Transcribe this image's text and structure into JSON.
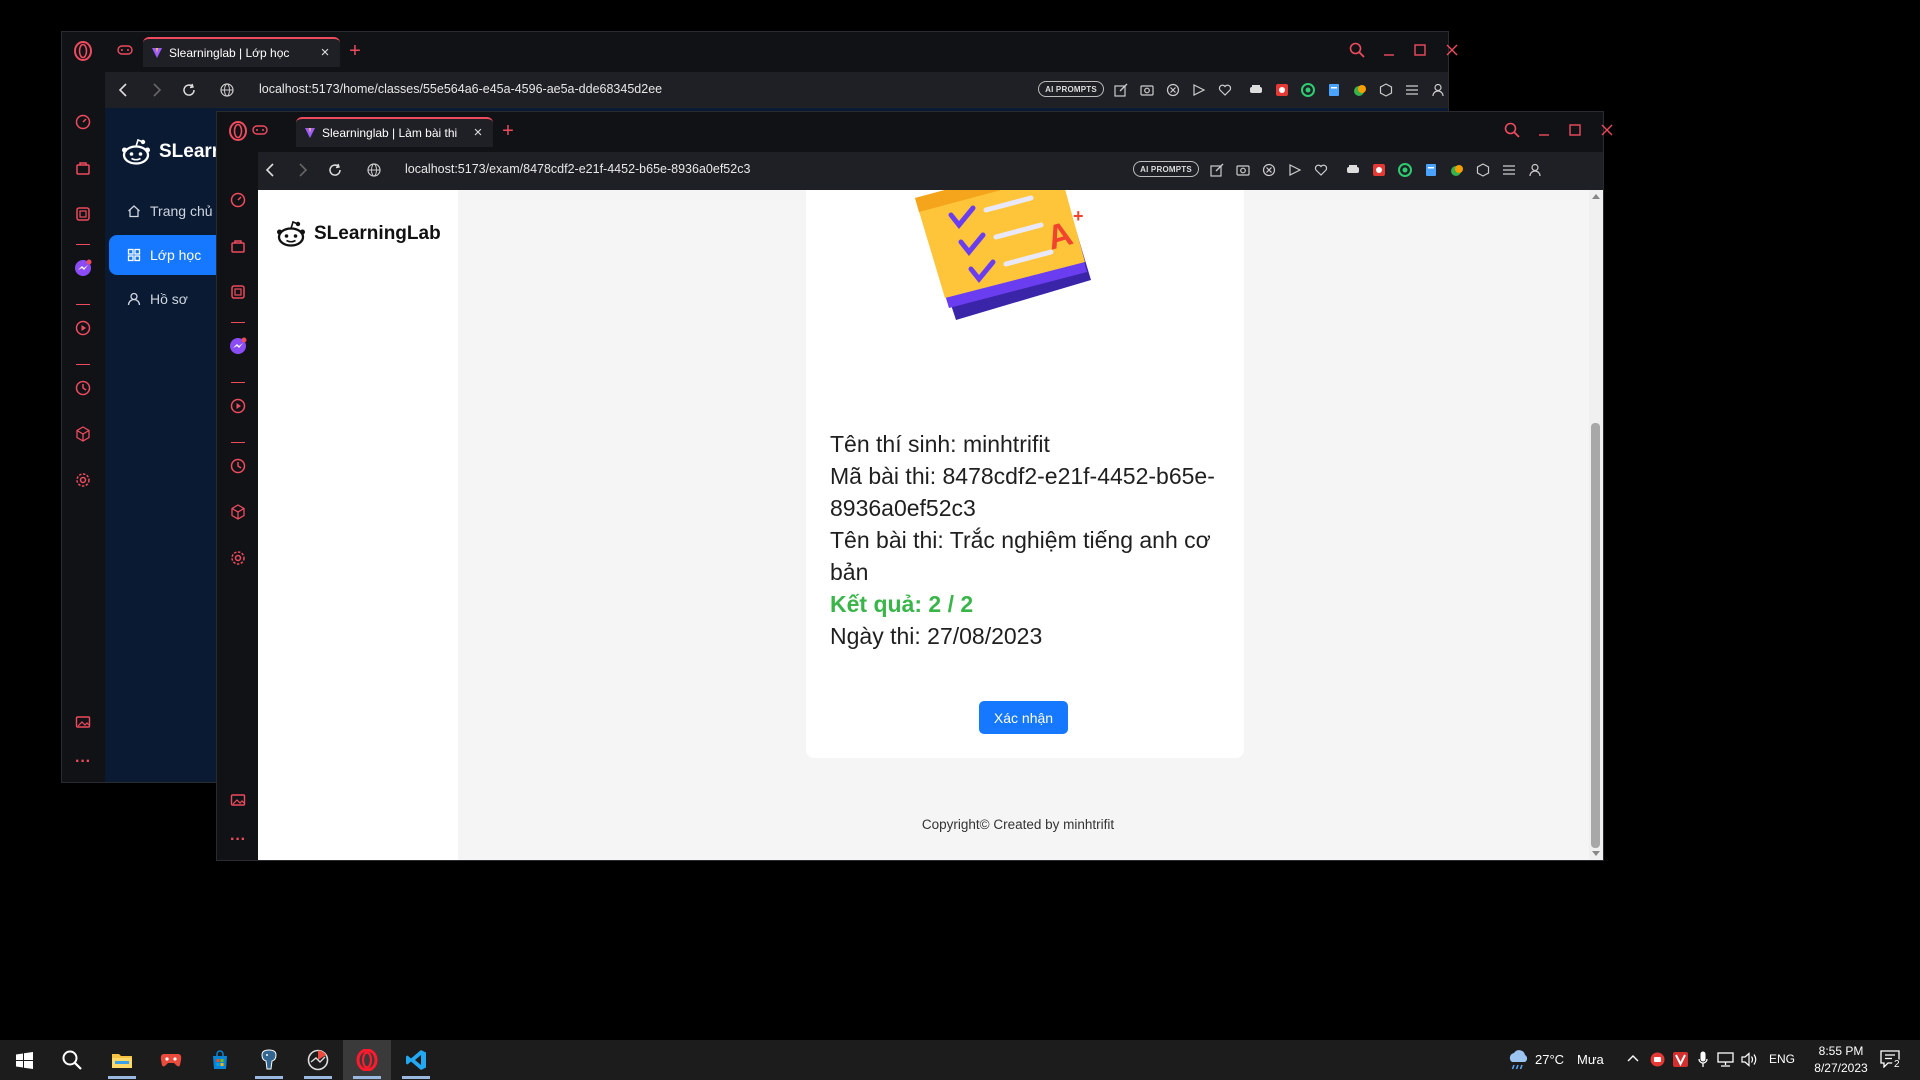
{
  "back_window": {
    "tab_title": "Slearninglab | Lớp học",
    "url": "localhost:5173/home/classes/55e564a6-e45a-4596-ae5a-dde68345d2ee",
    "ai_badge": "AI PROMPTS",
    "app": {
      "logo_text": "SLearr",
      "nav": [
        {
          "label": "Trang chủ",
          "icon": "home-icon",
          "active": false
        },
        {
          "label": "Lớp học",
          "icon": "grid-icon",
          "active": true
        },
        {
          "label": "Hồ sơ",
          "icon": "user-icon",
          "active": false
        }
      ]
    }
  },
  "front_window": {
    "tab_title": "Slearninglab | Làm bài thi",
    "url": "localhost:5173/exam/8478cdf2-e21f-4452-b65e-8936a0ef52c3",
    "ai_badge": "AI PROMPTS",
    "app": {
      "logo_text": "SLearningLab",
      "exam_info": {
        "candidate": "Tên thí sinh: minhtrifit",
        "exam_id": "Mã bài thi: 8478cdf2-e21f-4452-b65e-8936a0ef52c3",
        "exam_name": "Tên bài thi: Trắc nghiệm tiếng anh cơ bản",
        "result": "Kết quả: 2 / 2",
        "date": "Ngày thi: 27/08/2023"
      },
      "confirm_label": "Xác nhận",
      "copyright": "Copyright© Created by minhtrifit"
    }
  },
  "taskbar": {
    "weather_temp": "27°C",
    "weather_desc": "Mưa",
    "language": "ENG",
    "time": "8:55 PM",
    "date": "8/27/2023",
    "notification_count": "2"
  },
  "colors": {
    "opera_red": "#ee4b5e",
    "primary_blue": "#1677ff",
    "result_green": "#3ab54a",
    "back_app_bg": "#0a1a33"
  }
}
